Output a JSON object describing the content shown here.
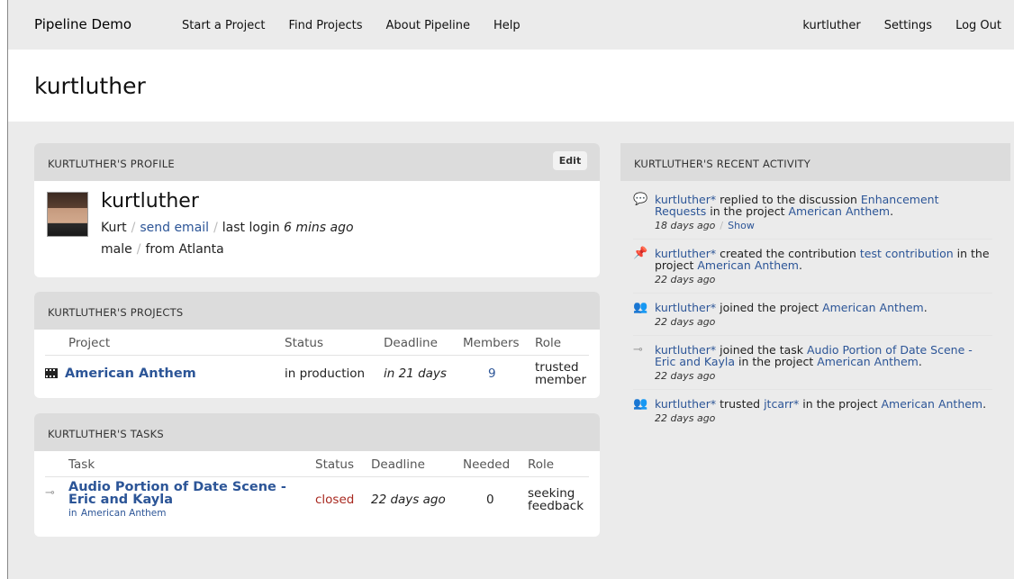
{
  "nav": {
    "brand": "Pipeline Demo",
    "left": [
      "Start a Project",
      "Find Projects",
      "About Pipeline",
      "Help"
    ],
    "right": [
      "kurtluther",
      "Settings",
      "Log Out"
    ]
  },
  "page_title": "kurtluther",
  "profile": {
    "header": "KURTLUTHER'S PROFILE",
    "edit": "Edit",
    "username": "kurtluther",
    "first_name": "Kurt",
    "send_email": "send email",
    "last_login_label": "last login",
    "last_login": "6 mins ago",
    "gender": "male",
    "location": "from Atlanta"
  },
  "projects": {
    "header": "KURTLUTHER'S PROJECTS",
    "columns": [
      "Project",
      "Status",
      "Deadline",
      "Members",
      "Role"
    ],
    "rows": [
      {
        "name": "American Anthem",
        "status": "in production",
        "deadline": "in 21 days",
        "members": "9",
        "role_1": "trusted",
        "role_2": "member"
      }
    ]
  },
  "tasks": {
    "header": "KURTLUTHER'S TASKS",
    "columns": [
      "Task",
      "Status",
      "Deadline",
      "Needed",
      "Role"
    ],
    "rows": [
      {
        "name_1": "Audio Portion of Date Scene -",
        "name_2": "Eric and Kayla",
        "in_label": "in",
        "project": "American Anthem",
        "status": "closed",
        "deadline": "22 days ago",
        "needed": "0",
        "role_1": "seeking",
        "role_2": "feedback"
      }
    ]
  },
  "activity": {
    "header": "KURTLUTHER'S RECENT ACTIVITY",
    "items": [
      {
        "icon": "discussion-icon",
        "user": "kurtluther*",
        "t1": " replied to the discussion ",
        "l1": "Enhancement Requests",
        "t2": " in the project ",
        "l2": "American Anthem",
        "t3": ".",
        "when": "18 days ago",
        "show": "Show"
      },
      {
        "icon": "pin-icon",
        "user": "kurtluther*",
        "t1": " created the contribution ",
        "l1": "test contribution",
        "t2": " in the project ",
        "l2": "American Anthem",
        "t3": ".",
        "when": "22 days ago"
      },
      {
        "icon": "people-icon",
        "user": "kurtluther*",
        "t1": " joined the project ",
        "l1": "American Anthem",
        "t2": ".",
        "when": "22 days ago"
      },
      {
        "icon": "task-icon",
        "user": "kurtluther*",
        "t1": " joined the task ",
        "l1": "Audio Portion of Date Scene - Eric and Kayla",
        "t2": " in the project ",
        "l2": "American Anthem",
        "t3": ".",
        "when": "22 days ago"
      },
      {
        "icon": "people-icon",
        "user": "kurtluther*",
        "t1": " trusted ",
        "l1": "jtcarr*",
        "t2": " in the project ",
        "l2": "American Anthem",
        "t3": ".",
        "when": "22 days ago"
      }
    ]
  }
}
